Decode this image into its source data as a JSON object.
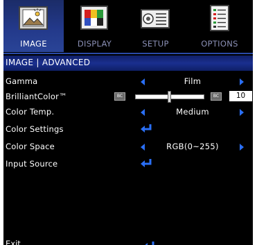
{
  "tabs": [
    {
      "label": "IMAGE",
      "active": true,
      "icon": "image-icon"
    },
    {
      "label": "DISPLAY",
      "active": false,
      "icon": "display-icon"
    },
    {
      "label": "SETUP",
      "active": false,
      "icon": "projector-icon"
    },
    {
      "label": "OPTIONS",
      "active": false,
      "icon": "options-list-icon"
    }
  ],
  "header": {
    "title": "IMAGE | ADVANCED"
  },
  "rows": {
    "gamma": {
      "label": "Gamma",
      "value": "Film"
    },
    "brilliant": {
      "label": "BrilliantColor™",
      "value": "10",
      "min_badge": "BC",
      "max_badge": "BC",
      "level": 0.5
    },
    "color_temp": {
      "label": "Color Temp.",
      "value": "Medium"
    },
    "color_settings": {
      "label": "Color Settings"
    },
    "color_space": {
      "label": "Color Space",
      "value": "RGB(0~255)"
    },
    "input_source": {
      "label": "Input Source"
    }
  },
  "footer": {
    "exit_label": "Exit"
  },
  "colors": {
    "accent": "#2a6ff5",
    "header": "#1a2f8f",
    "active_tab": "#23398a",
    "background": "#000000"
  }
}
